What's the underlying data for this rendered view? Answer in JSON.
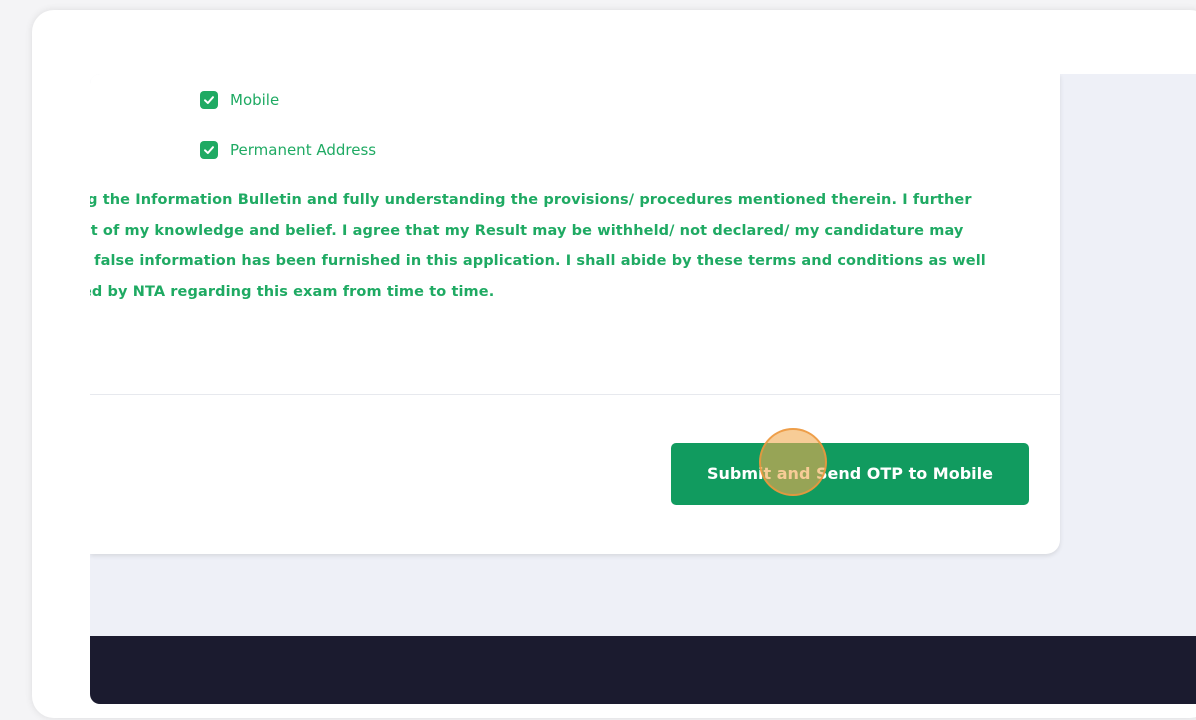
{
  "checkboxes": [
    {
      "label": "Mobile",
      "checked": true
    },
    {
      "label": "Permanent Address",
      "checked": true
    }
  ],
  "declaration_lines": [
    "ıg the Information Bulletin and fully understanding the provisions/ procedures mentioned therein. I further",
    "st of my knowledge and belief. I agree that my Result may be withheld/ not declared/ my candidature may",
    "t false information has been furnished in this application. I shall abide by these terms and conditions as well",
    "ed by NTA regarding this exam from time to time."
  ],
  "submit_button": {
    "label": "Submit and Send OTP to Mobile"
  },
  "colors": {
    "accent_green": "#1faa63",
    "button_green": "#119b5f",
    "footer_dark": "#1b1b2f",
    "click_indicator": "#f2aa50"
  },
  "icons": {
    "checkbox": "checkmark-icon"
  }
}
